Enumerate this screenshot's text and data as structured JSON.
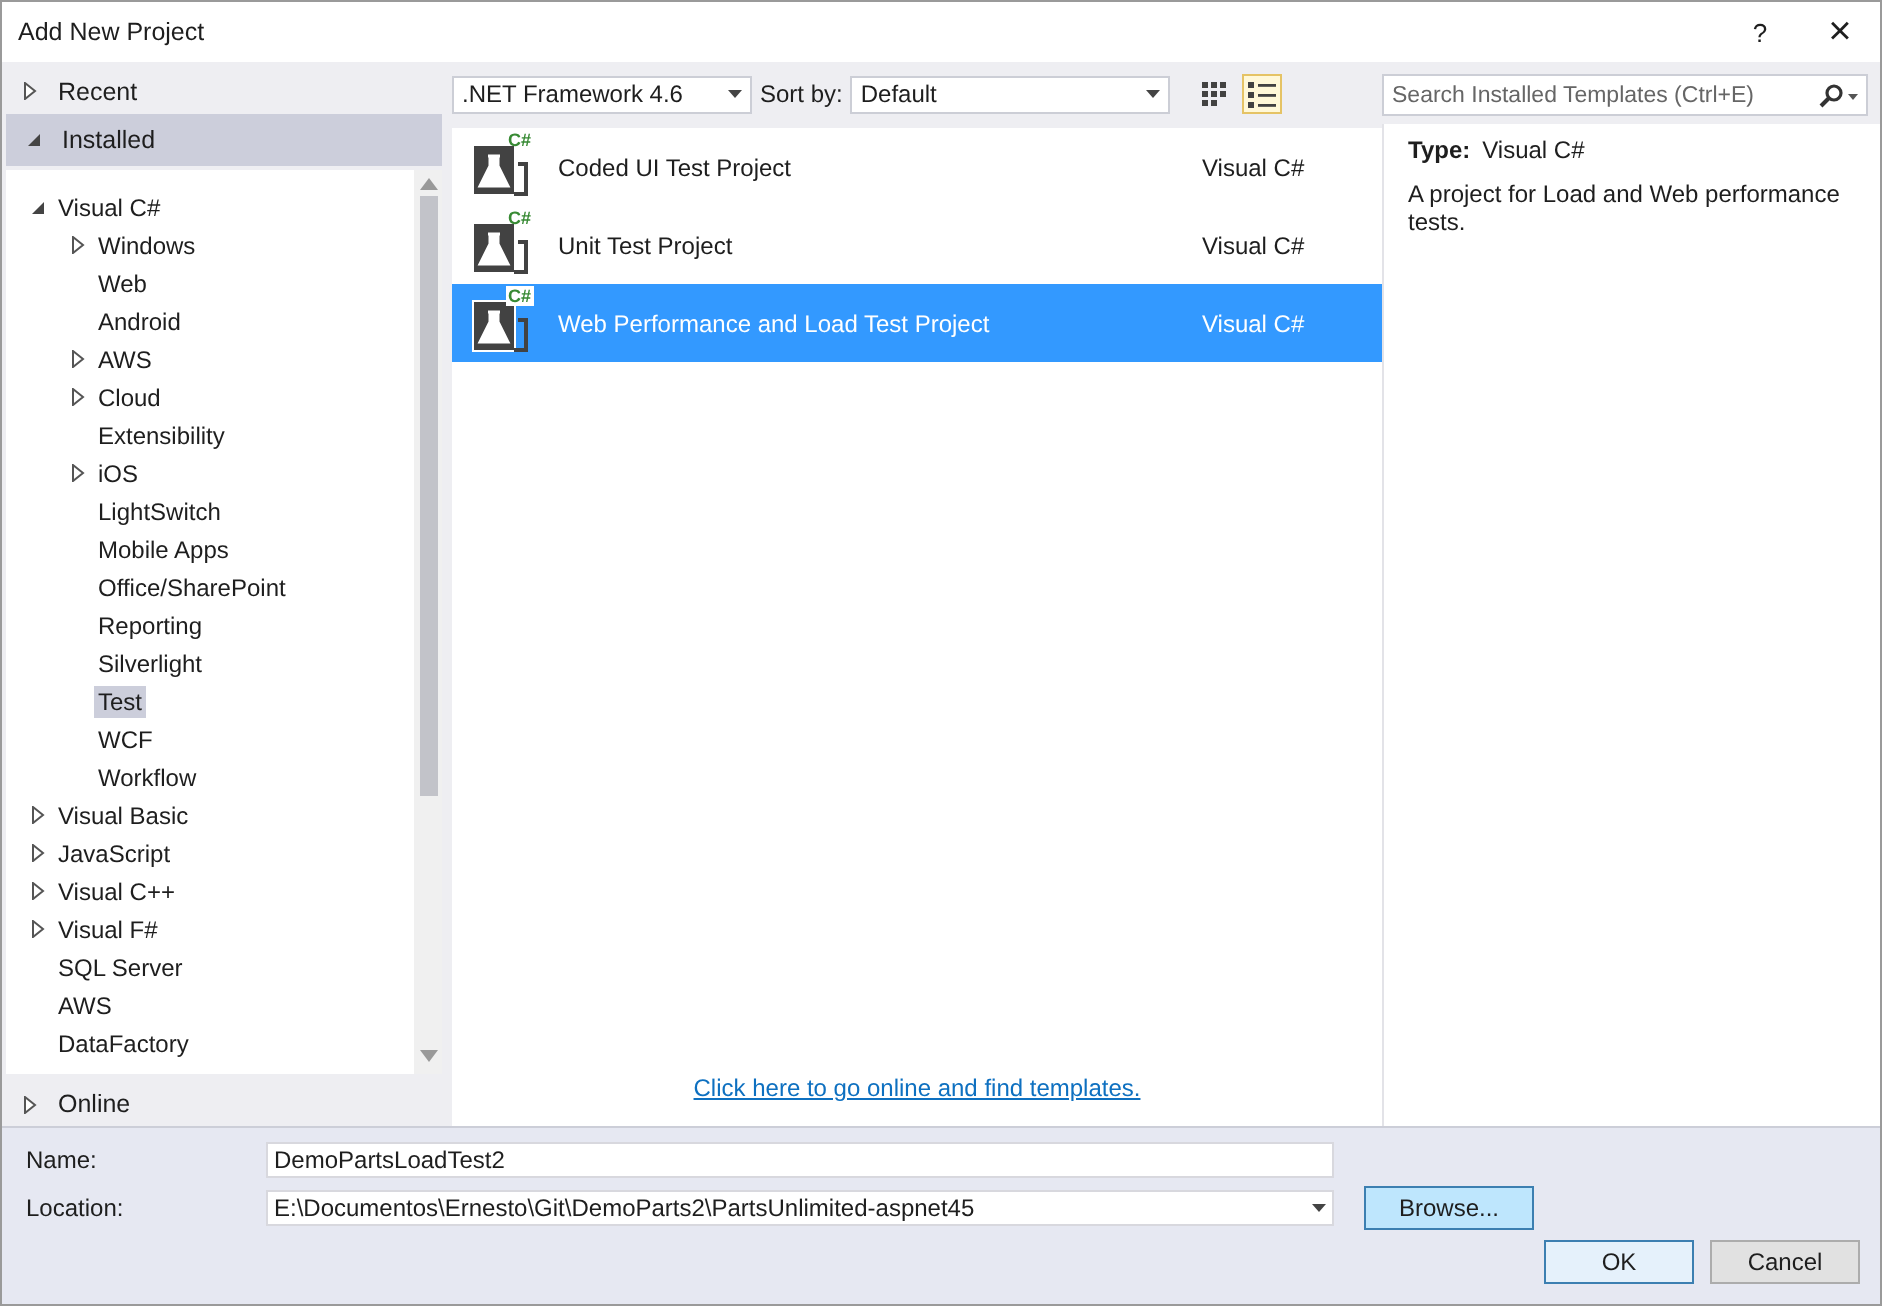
{
  "window": {
    "title": "Add New Project",
    "help": "?",
    "close": "×"
  },
  "sidebar": {
    "sections": [
      {
        "label": "Recent",
        "expanded": false,
        "selected": false
      },
      {
        "label": "Installed",
        "expanded": true,
        "selected": true
      },
      {
        "label": "Online",
        "expanded": false,
        "selected": false
      }
    ],
    "tree": [
      {
        "label": "Visual C#",
        "expanded": true,
        "selected": false,
        "children": [
          {
            "label": "Windows",
            "expanded": false,
            "selected": false
          },
          {
            "label": "Web",
            "selected": false
          },
          {
            "label": "Android",
            "selected": false
          },
          {
            "label": "AWS",
            "expanded": false,
            "selected": false
          },
          {
            "label": "Cloud",
            "expanded": false,
            "selected": false
          },
          {
            "label": "Extensibility",
            "selected": false
          },
          {
            "label": "iOS",
            "expanded": false,
            "selected": false
          },
          {
            "label": "LightSwitch",
            "selected": false
          },
          {
            "label": "Mobile Apps",
            "selected": false
          },
          {
            "label": "Office/SharePoint",
            "selected": false
          },
          {
            "label": "Reporting",
            "selected": false
          },
          {
            "label": "Silverlight",
            "selected": false
          },
          {
            "label": "Test",
            "selected": true
          },
          {
            "label": "WCF",
            "selected": false
          },
          {
            "label": "Workflow",
            "selected": false
          }
        ]
      },
      {
        "label": "Visual Basic",
        "expanded": false,
        "selected": false
      },
      {
        "label": "JavaScript",
        "expanded": false,
        "selected": false
      },
      {
        "label": "Visual C++",
        "expanded": false,
        "selected": false
      },
      {
        "label": "Visual F#",
        "expanded": false,
        "selected": false
      },
      {
        "label": "SQL Server",
        "selected": false
      },
      {
        "label": "AWS",
        "selected": false
      },
      {
        "label": "DataFactory",
        "selected": false
      }
    ]
  },
  "toolbar": {
    "framework": ".NET Framework 4.6",
    "sort_label": "Sort by:",
    "sort_value": "Default",
    "view_buttons": [
      {
        "kind": "grid",
        "selected": false
      },
      {
        "kind": "list",
        "selected": true
      }
    ],
    "search": {
      "placeholder": "Search Installed Templates (Ctrl+E)"
    }
  },
  "templates": [
    {
      "name": "Coded UI Test Project",
      "language": "Visual C#",
      "badge": "C#",
      "selected": false
    },
    {
      "name": "Unit Test Project",
      "language": "Visual C#",
      "badge": "C#",
      "selected": false
    },
    {
      "name": "Web Performance and Load Test Project",
      "language": "Visual C#",
      "badge": "C#",
      "selected": true
    }
  ],
  "online_link": "Click here to go online and find templates.",
  "details": {
    "type_label": "Type:",
    "type_value": "Visual C#",
    "description": "A project for Load and Web performance tests."
  },
  "form": {
    "name_label": "Name:",
    "name_value": "DemoPartsLoadTest2",
    "location_label": "Location:",
    "location_value": "E:\\Documentos\\Ernesto\\Git\\DemoParts2\\PartsUnlimited-aspnet45",
    "browse": "Browse..."
  },
  "buttons": [
    {
      "label": "OK",
      "kind": "default"
    },
    {
      "label": "Cancel",
      "kind": "normal"
    }
  ]
}
